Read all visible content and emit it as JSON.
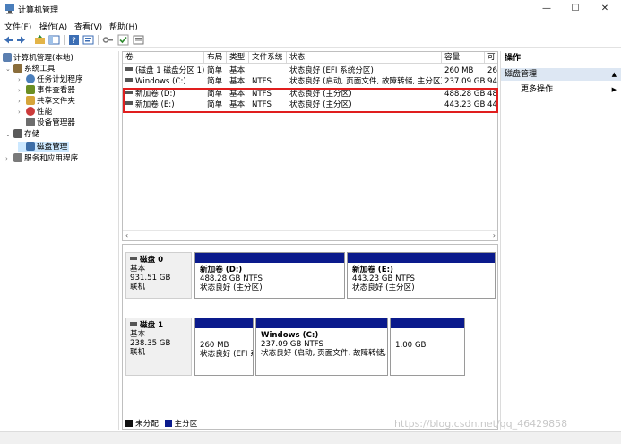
{
  "window": {
    "title": "计算机管理",
    "minimize": "—",
    "maximize": "☐",
    "close": "✕"
  },
  "menu": [
    "文件(F)",
    "操作(A)",
    "查看(V)",
    "帮助(H)"
  ],
  "tree": [
    {
      "label": "计算机管理(本地)",
      "level": 0,
      "twisty": "",
      "icon_color": "#5b7fb0"
    },
    {
      "label": "系统工具",
      "level": 1,
      "twisty": "⌄",
      "icon_color": "#8a6d3b"
    },
    {
      "label": "任务计划程序",
      "level": 2,
      "twisty": "›",
      "icon_color": "#4a7ebb"
    },
    {
      "label": "事件查看器",
      "level": 2,
      "twisty": "›",
      "icon_color": "#6b8e23"
    },
    {
      "label": "共享文件夹",
      "level": 2,
      "twisty": "›",
      "icon_color": "#d6a53a"
    },
    {
      "label": "性能",
      "level": 2,
      "twisty": "›",
      "icon_color": "#cc3b3b"
    },
    {
      "label": "设备管理器",
      "level": 2,
      "twisty": "",
      "icon_color": "#6d6d6d"
    },
    {
      "label": "存储",
      "level": 1,
      "twisty": "⌄",
      "icon_color": "#5a5a5a"
    },
    {
      "label": "磁盘管理",
      "level": 2,
      "twisty": "",
      "icon_color": "#3d6ea8",
      "selected": true
    },
    {
      "label": "服务和应用程序",
      "level": 1,
      "twisty": "›",
      "icon_color": "#7a7a7a"
    }
  ],
  "volume_table": {
    "headers": [
      "卷",
      "布局",
      "类型",
      "文件系统",
      "状态",
      "容量",
      "可"
    ],
    "rows": [
      [
        "(磁盘 1 磁盘分区 1)",
        "简单",
        "基本",
        "",
        "状态良好 (EFI 系统分区)",
        "260 MB",
        "26"
      ],
      [
        "Windows (C:)",
        "简单",
        "基本",
        "NTFS",
        "状态良好 (启动, 页面文件, 故障转储, 主分区)",
        "237.09 GB",
        "94"
      ],
      [
        "新加卷 (D:)",
        "简单",
        "基本",
        "NTFS",
        "状态良好 (主分区)",
        "488.28 GB",
        "48"
      ],
      [
        "新加卷 (E:)",
        "简单",
        "基本",
        "NTFS",
        "状态良好 (主分区)",
        "443.23 GB",
        "44"
      ]
    ]
  },
  "disks": [
    {
      "name": "磁盘 0",
      "type": "基本",
      "size": "931.51 GB",
      "status": "联机",
      "partitions": [
        {
          "name": "新加卷  (D:)",
          "size": "488.28 GB NTFS",
          "status": "状态良好 (主分区)"
        },
        {
          "name": "新加卷  (E:)",
          "size": "443.23 GB NTFS",
          "status": "状态良好 (主分区)"
        }
      ]
    },
    {
      "name": "磁盘 1",
      "type": "基本",
      "size": "238.35 GB",
      "status": "联机",
      "partitions": [
        {
          "name": "",
          "size": "260 MB",
          "status": "状态良好 (EFI 系"
        },
        {
          "name": "Windows  (C:)",
          "size": "237.09 GB NTFS",
          "status": "状态良好 (启动, 页面文件, 故障转储, 主"
        },
        {
          "name": "",
          "size": "1.00 GB",
          "status": ""
        }
      ]
    }
  ],
  "legend": {
    "unallocated": "未分配",
    "primary": "主分区"
  },
  "colors": {
    "unallocated": "#111111",
    "primary": "#0a1a8c",
    "highlight": "#e01e1e"
  },
  "actions": {
    "title": "操作",
    "section": "磁盘管理",
    "more": "更多操作"
  },
  "watermark": "https://blog.csdn.net/qq_46429858"
}
